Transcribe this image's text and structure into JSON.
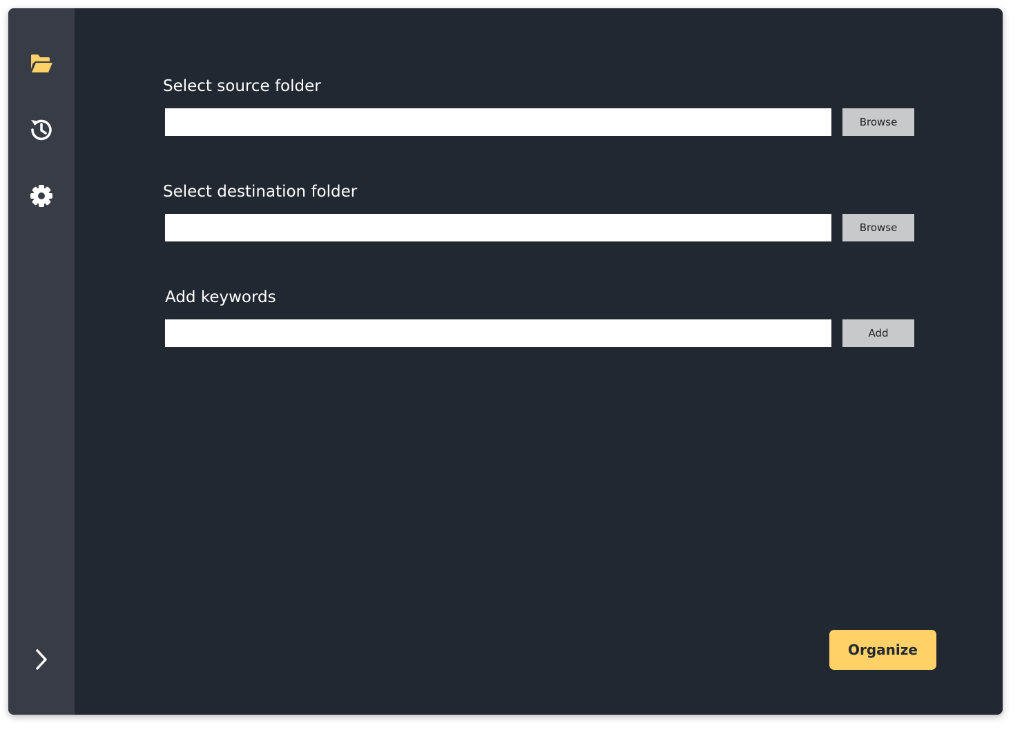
{
  "sidebar": {
    "items": [
      {
        "icon": "folder-open-icon",
        "active": true
      },
      {
        "icon": "history-icon",
        "active": false
      },
      {
        "icon": "gear-icon",
        "active": false
      }
    ],
    "expand_icon": "chevron-right-icon"
  },
  "colors": {
    "background": "#222832",
    "sidebar": "#383c46",
    "accent": "#ffd166",
    "secondary_button": "#c8c9cb"
  },
  "source": {
    "label": "Select source folder",
    "value": "",
    "placeholder": "",
    "button_label": "Browse"
  },
  "destination": {
    "label": "Select destination folder",
    "value": "",
    "placeholder": "",
    "button_label": "Browse"
  },
  "keywords": {
    "label": "Add keywords",
    "value": "",
    "placeholder": "",
    "button_label": "Add"
  },
  "organize_label": "Organize"
}
